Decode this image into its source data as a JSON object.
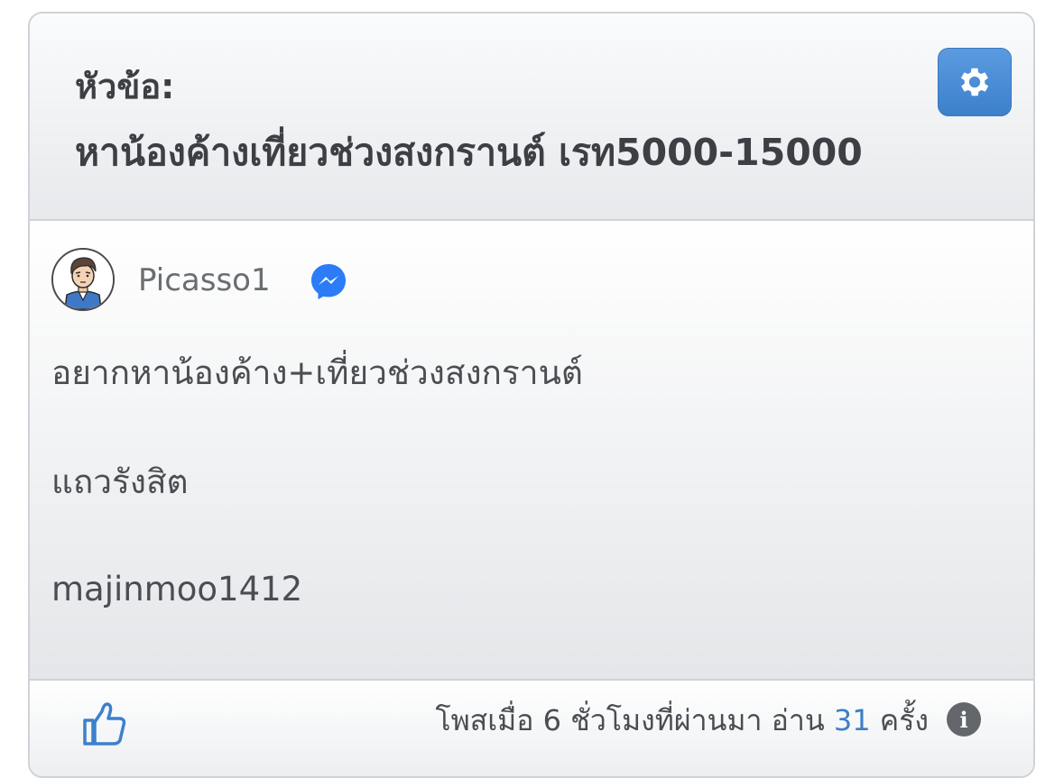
{
  "topic": {
    "label": "หัวข้อ:",
    "title": "หาน้องค้างเที่ยวช่วงสงกรานต์ เรท5000-15000"
  },
  "settings_icon": "gear-icon",
  "post": {
    "author": "Picasso1",
    "messenger_icon": "messenger-icon",
    "lines": [
      "อยากหาน้องค้าง+เที่ยวช่วงสงกรานต์",
      "แถวรังสิต",
      "majinmoo1412"
    ]
  },
  "footer": {
    "like_icon": "thumbs-up-icon",
    "posted_prefix": "โพสเมื่อ 6 ชั่วโมงที่ผ่านมา อ่าน",
    "read_count": "31",
    "read_suffix": "ครั้ง",
    "info_icon": "info-icon",
    "info_glyph": "i"
  },
  "colors": {
    "accent_button": "#4a8ad6",
    "link_count": "#3c7fc8",
    "messenger": "#2b7cf6"
  }
}
